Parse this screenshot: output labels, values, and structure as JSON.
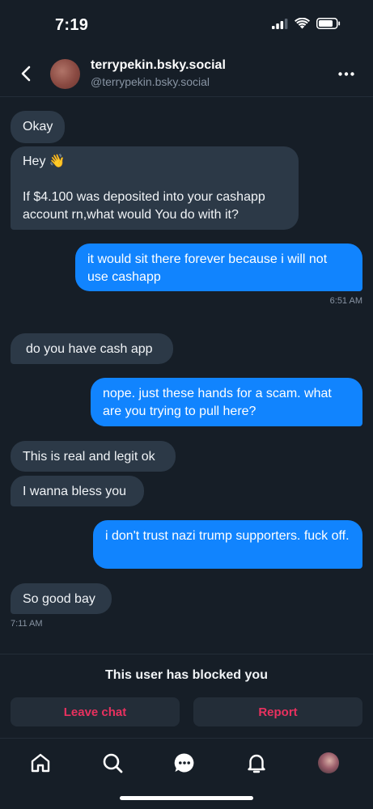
{
  "status_bar": {
    "time": "7:19"
  },
  "header": {
    "display_name": "terrypekin.bsky.social",
    "handle": "@terrypekin.bsky.social"
  },
  "messages": [
    {
      "dir": "in",
      "text": "Okay"
    },
    {
      "dir": "in",
      "text": "Hey 👋\n\nIf $4.100 was deposited into your cashapp account rn,what would You do with it?"
    },
    {
      "dir": "out",
      "text": "it would sit there forever because i will not use cashapp",
      "timestamp": "6:51 AM"
    },
    {
      "dir": "in",
      "text": "do you have cash app"
    },
    {
      "dir": "out",
      "text": "nope. just these hands for a scam. what are you trying to pull here?"
    },
    {
      "dir": "in",
      "text": "This is real and legit ok"
    },
    {
      "dir": "in",
      "text": "I wanna bless you"
    },
    {
      "dir": "out",
      "text": "i don't trust nazi trump supporters. fuck off."
    },
    {
      "dir": "in",
      "text": "So good bay",
      "timestamp": "7:11 AM"
    }
  ],
  "blocked_banner": {
    "text": "This user has blocked you",
    "leave_label": "Leave chat",
    "report_label": "Report"
  },
  "colors": {
    "background": "#161e27",
    "incoming_bubble": "#2c3947",
    "outgoing_bubble": "#1184fe",
    "danger": "#e8315f"
  },
  "tabbar": {
    "items": [
      "home-icon",
      "search-icon",
      "chat-icon",
      "notifications-icon",
      "profile-avatar"
    ],
    "active": "chat-icon"
  }
}
